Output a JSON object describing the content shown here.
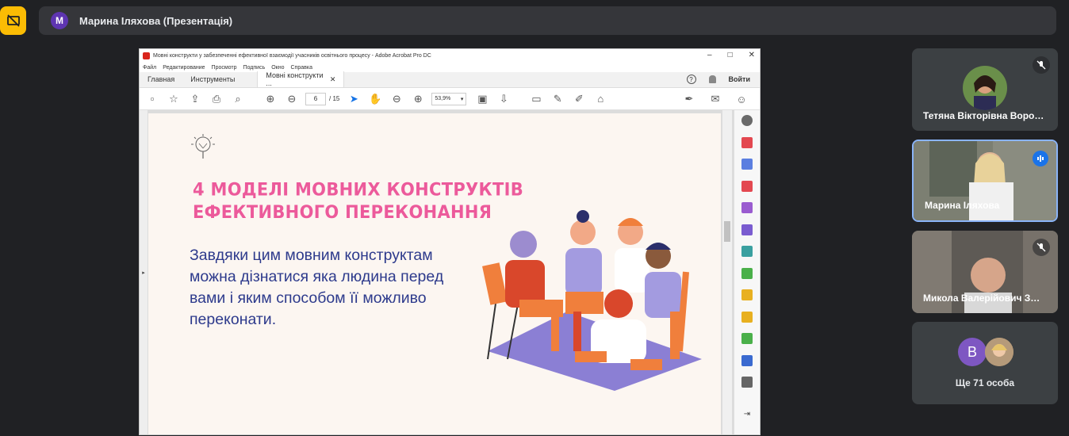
{
  "meet": {
    "presenter_initial": "М",
    "presenter_label": "Марина Іляхова (Презентація)"
  },
  "acrobat": {
    "title": "Мовні конструкти у забезпеченні ефективної взаємодії учасників освітнього процесу - Adobe Acrobat Pro DC",
    "menu": [
      "Файл",
      "Редактирование",
      "Просмотр",
      "Подпись",
      "Окно",
      "Справка"
    ],
    "tabs": {
      "home": "Главная",
      "tools": "Инструменты",
      "doc": "Мовні конструкти ..."
    },
    "help": "?",
    "login": "Войти",
    "page_current": "6",
    "page_total": "/ 15",
    "zoom": "53,9%"
  },
  "slide": {
    "title_line1": "4 МОДЕЛІ МОВНИХ КОНСТРУКТІВ",
    "title_line2": "ЕФЕКТИВНОГО ПЕРЕКОНАННЯ",
    "body": "Завдяки цим мовним конструктам можна дізнатися яка людина перед вами і яким способом її можливо переконати."
  },
  "participants": [
    {
      "name": "Тетяна Вікторівна Воро…",
      "muted": true
    },
    {
      "name": "Марина Іляхова",
      "speaking": true
    },
    {
      "name": "Микола Валерійович З…",
      "muted": true
    }
  ],
  "more": {
    "initial": "В",
    "label": "Ще 71 особа"
  },
  "colors": {
    "accent_yellow": "#fbbc04",
    "meet_bg": "#202124",
    "slide_pink": "#ec5a9b",
    "slide_navy": "#2d3a8c",
    "speaking_blue": "#1a73e8"
  }
}
